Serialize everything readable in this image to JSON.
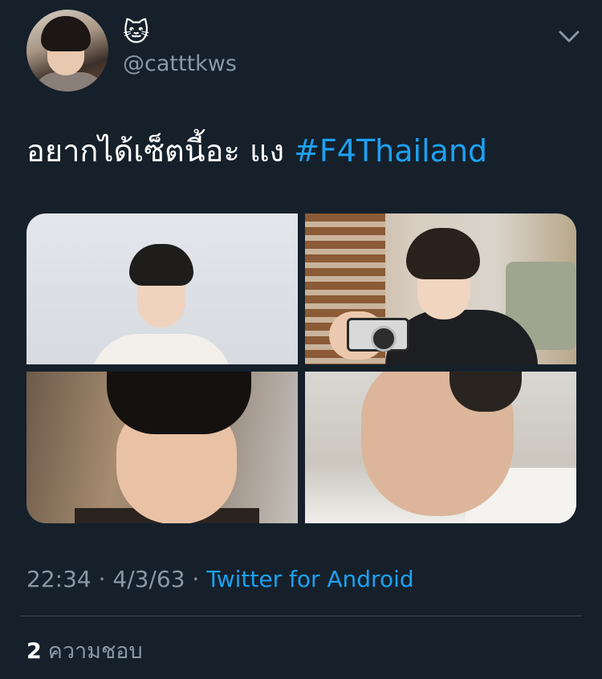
{
  "author": {
    "display_name": "🐱",
    "handle": "@catttkws",
    "avatar_icon": "profile-photo"
  },
  "tweet": {
    "text": "อยากได้เซ็ตนี้อะ แง ",
    "hashtag": "#F4Thailand",
    "media_count": 4
  },
  "meta": {
    "time": "22:34",
    "separator_1": " · ",
    "date": "4/3/63",
    "separator_2": " · ",
    "source": "Twitter for Android"
  },
  "engagement": {
    "likes_count": "2",
    "likes_label": "ความชอบ"
  },
  "icons": {
    "menu": "chevron-down-icon"
  },
  "colors": {
    "background": "#15202b",
    "link": "#1da1f2",
    "secondary_text": "#8899a6",
    "divider": "#38444d"
  }
}
